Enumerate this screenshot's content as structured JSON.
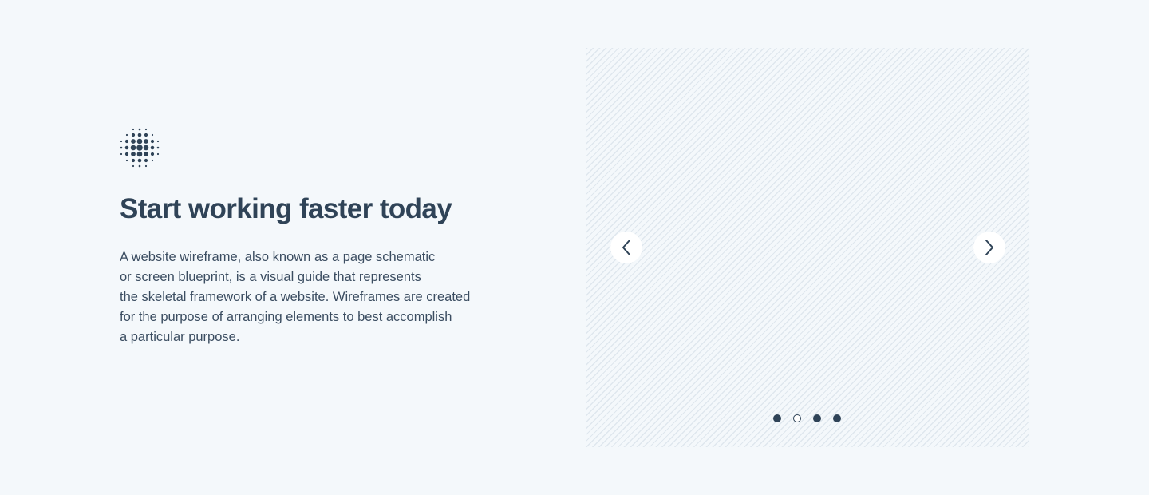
{
  "hero": {
    "logo_icon": "dot-grid-logo-icon",
    "title": "Start working faster today",
    "description_lines": [
      "A website wireframe, also known as a page schematic",
      "or screen blueprint, is a visual guide that represents",
      "the skeletal framework of a website. Wireframes are created",
      "for the purpose of arranging elements to best accomplish",
      "a particular purpose."
    ]
  },
  "carousel": {
    "prev_icon": "chevron-left-icon",
    "next_icon": "chevron-right-icon",
    "dots": [
      {
        "filled": true
      },
      {
        "filled": false
      },
      {
        "filled": true
      },
      {
        "filled": true
      }
    ]
  },
  "colors": {
    "background": "#f4f8fb",
    "text": "#2f4357",
    "stripe": "#dfe7ee"
  }
}
